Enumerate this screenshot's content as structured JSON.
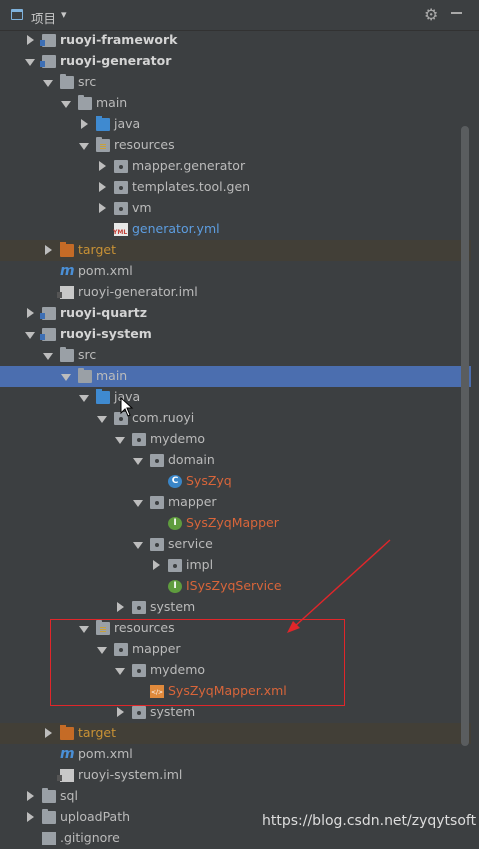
{
  "header": {
    "title": "项目",
    "caret": "▾",
    "gear": "⚙"
  },
  "tree": [
    {
      "label": "ruoyi-framework",
      "expanded": false,
      "icon": "module-folder",
      "style": "bold"
    },
    {
      "label": "ruoyi-generator",
      "expanded": true,
      "icon": "module-folder",
      "style": "bold"
    },
    {
      "label": "src",
      "expanded": true,
      "icon": "folder"
    },
    {
      "label": "main",
      "expanded": true,
      "icon": "folder"
    },
    {
      "label": "java",
      "expanded": false,
      "icon": "source-folder"
    },
    {
      "label": "resources",
      "expanded": true,
      "icon": "resources-folder"
    },
    {
      "label": "mapper.generator",
      "expanded": false,
      "icon": "package"
    },
    {
      "label": "templates.tool.gen",
      "expanded": false,
      "icon": "package"
    },
    {
      "label": "vm",
      "expanded": false,
      "icon": "package"
    },
    {
      "label": "generator.yml",
      "icon": "yml-file",
      "style": "blue"
    },
    {
      "label": "target",
      "expanded": false,
      "icon": "excluded-folder",
      "style": "orange"
    },
    {
      "label": "pom.xml",
      "icon": "maven-file"
    },
    {
      "label": "ruoyi-generator.iml",
      "icon": "iml-file"
    },
    {
      "label": "ruoyi-quartz",
      "expanded": false,
      "icon": "module-folder",
      "style": "bold"
    },
    {
      "label": "ruoyi-system",
      "expanded": true,
      "icon": "module-folder",
      "style": "bold"
    },
    {
      "label": "src",
      "expanded": true,
      "icon": "folder"
    },
    {
      "label": "main",
      "expanded": true,
      "icon": "folder",
      "selected": true
    },
    {
      "label": "java",
      "expanded": true,
      "icon": "source-folder"
    },
    {
      "label": "com.ruoyi",
      "expanded": true,
      "icon": "package"
    },
    {
      "label": "mydemo",
      "expanded": true,
      "icon": "package"
    },
    {
      "label": "domain",
      "expanded": true,
      "icon": "package"
    },
    {
      "label": "SysZyq",
      "icon": "class-file",
      "style": "red"
    },
    {
      "label": "mapper",
      "expanded": true,
      "icon": "package"
    },
    {
      "label": "SysZyqMapper",
      "icon": "interface-file",
      "style": "red"
    },
    {
      "label": "service",
      "expanded": true,
      "icon": "package"
    },
    {
      "label": "impl",
      "expanded": false,
      "icon": "package"
    },
    {
      "label": "ISysZyqService",
      "icon": "interface-file",
      "style": "red"
    },
    {
      "label": "system",
      "expanded": false,
      "icon": "package"
    },
    {
      "label": "resources",
      "expanded": true,
      "icon": "resources-folder"
    },
    {
      "label": "mapper",
      "expanded": true,
      "icon": "package"
    },
    {
      "label": "mydemo",
      "expanded": true,
      "icon": "package"
    },
    {
      "label": "SysZyqMapper.xml",
      "icon": "xml-file",
      "style": "red"
    },
    {
      "label": "system",
      "expanded": false,
      "icon": "package"
    },
    {
      "label": "target",
      "expanded": false,
      "icon": "excluded-folder",
      "style": "orange"
    },
    {
      "label": "pom.xml",
      "icon": "maven-file"
    },
    {
      "label": "ruoyi-system.iml",
      "icon": "iml-file"
    },
    {
      "label": "sql",
      "expanded": false,
      "icon": "folder"
    },
    {
      "label": "uploadPath",
      "expanded": false,
      "icon": "folder"
    },
    {
      "label": ".gitignore",
      "icon": "git-file"
    }
  ],
  "watermark": "https://blog.csdn.net/zyqytsoft",
  "colors": {
    "selection": "#4b6eaf",
    "annotation": "#e0262a"
  }
}
